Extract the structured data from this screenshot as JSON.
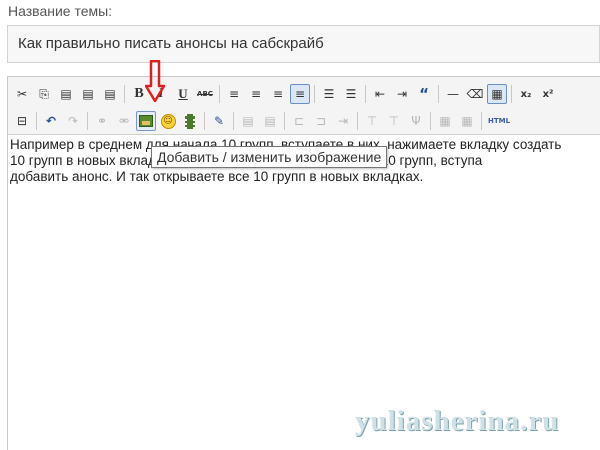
{
  "form": {
    "topic_label": "Название темы:",
    "topic_value": "Как правильно писать анонсы на сабскрайб"
  },
  "toolbar": {
    "row1": [
      {
        "name": "cut-icon",
        "glyph": "✂"
      },
      {
        "name": "copy-icon",
        "glyph": "⎘"
      },
      {
        "name": "paste-icon",
        "glyph": "📋"
      },
      {
        "name": "paste-text-icon",
        "glyph": "📋"
      },
      {
        "name": "paste-word-icon",
        "glyph": "📋"
      },
      {
        "name": "bold-button",
        "glyph": "B"
      },
      {
        "name": "italic-button",
        "glyph": "I"
      },
      {
        "name": "underline-button",
        "glyph": "U"
      },
      {
        "name": "strikethrough-button",
        "glyph": "ABC"
      },
      {
        "name": "align-left-icon",
        "glyph": "≡"
      },
      {
        "name": "align-center-icon",
        "glyph": "≡"
      },
      {
        "name": "align-right-icon",
        "glyph": "≡"
      },
      {
        "name": "align-justify-icon",
        "glyph": "≡"
      },
      {
        "name": "bullet-list-icon",
        "glyph": "☰"
      },
      {
        "name": "numbered-list-icon",
        "glyph": "☰"
      },
      {
        "name": "outdent-icon",
        "glyph": "⇤"
      },
      {
        "name": "indent-icon",
        "glyph": "⇥"
      },
      {
        "name": "blockquote-icon",
        "glyph": "“"
      },
      {
        "name": "horizontal-rule-icon",
        "glyph": "—"
      },
      {
        "name": "eraser-icon",
        "glyph": "⌫"
      },
      {
        "name": "table-icon",
        "glyph": "▦"
      },
      {
        "name": "subscript-icon",
        "glyph": "x₂"
      },
      {
        "name": "superscript-icon",
        "glyph": "x²"
      }
    ],
    "html_label": "HTML"
  },
  "content": {
    "line1": "Например в среднем для начала 10 групп, вступаете в них, нажимаете вкладку создать",
    "line2": "10 групп в новых вкладках и вставляете анонс для начала 10 групп, вступа",
    "line3": "добавить анонс. И так открываете все 10 групп в новых вкладках."
  },
  "tooltip": {
    "text": "Добавить / изменить изображение"
  },
  "watermark": {
    "text": "yuliasherina.ru"
  },
  "colors": {
    "arrow": "#e02020",
    "toolbar_bg": "#f4f4f4",
    "active_border": "#6b8fc4"
  }
}
